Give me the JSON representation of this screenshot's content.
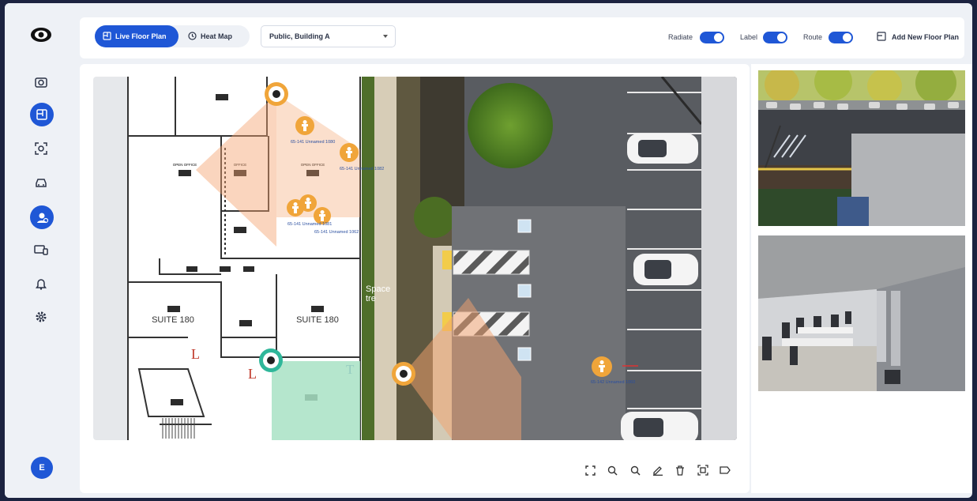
{
  "app": {
    "logo_icon": "eye-logo-icon",
    "accent": "#1f57d6"
  },
  "sidebar": {
    "items": [
      {
        "name": "camera",
        "icon": "camera-icon",
        "active": false
      },
      {
        "name": "floor-plan",
        "icon": "floor-plan-icon",
        "active": true
      },
      {
        "name": "face-recognition",
        "icon": "face-scan-icon",
        "active": false
      },
      {
        "name": "vehicle",
        "icon": "car-icon",
        "active": false
      },
      {
        "name": "person-search",
        "icon": "person-search-icon",
        "active": true
      },
      {
        "name": "devices",
        "icon": "devices-icon",
        "active": false
      },
      {
        "name": "alerts",
        "icon": "bell-icon",
        "active": false
      },
      {
        "name": "settings",
        "icon": "gear-icon",
        "active": false
      }
    ],
    "avatar_initial": "E"
  },
  "toolbar": {
    "tabs": [
      {
        "label": "Live Floor Plan",
        "active": true,
        "icon": "floor-plan-icon"
      },
      {
        "label": "Heat Map",
        "active": false,
        "icon": "clock-icon"
      }
    ],
    "location_select": {
      "value": "Public, Building A"
    },
    "toggles": [
      {
        "label": "Radiate",
        "on": true
      },
      {
        "label": "Label",
        "on": true
      },
      {
        "label": "Route",
        "on": true
      }
    ],
    "add_button": "Add New Floor Plan"
  },
  "map": {
    "rooms": {
      "open_office_1": "OPEN OFFICE",
      "open_office_2": "OPEN OFFICE",
      "office": "OFFICE",
      "suite_1": "SUITE 180",
      "suite_2": "SUITE 180",
      "letter_l1": "L",
      "letter_l2": "L",
      "letter_t": "T",
      "space_label": "Space",
      "space_label_2": "tre"
    },
    "person_labels": [
      "65-141 Unnamed 1080",
      "65-141 Unnamed 1082",
      "65-141 Unnamed 1081",
      "65-141 Unnamed 1062",
      "65-142 Unnamed 1060"
    ]
  },
  "map_tools": [
    {
      "name": "fit-screen",
      "icon": "fit-screen-icon"
    },
    {
      "name": "zoom-in",
      "icon": "zoom-in-icon"
    },
    {
      "name": "zoom-out",
      "icon": "zoom-out-icon"
    },
    {
      "name": "edit",
      "icon": "pencil-icon"
    },
    {
      "name": "delete",
      "icon": "trash-icon"
    },
    {
      "name": "camera-add",
      "icon": "camera-frame-icon"
    },
    {
      "name": "label",
      "icon": "tag-icon"
    }
  ],
  "camera_feeds": [
    {
      "name": "parking-lot-feed"
    },
    {
      "name": "office-interior-feed"
    }
  ]
}
